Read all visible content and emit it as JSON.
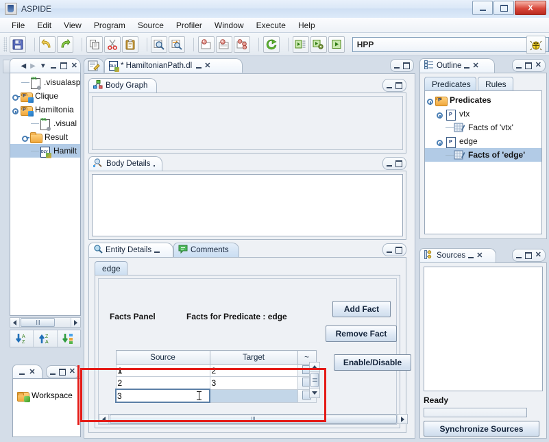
{
  "window": {
    "title": "ASPIDE",
    "icon": "java-app-icon",
    "buttons": {
      "minimize": "minimize",
      "maximize": "maximize",
      "close": "X"
    }
  },
  "menubar": {
    "items": [
      "File",
      "Edit",
      "View",
      "Program",
      "Source",
      "Profiler",
      "Window",
      "Execute",
      "Help"
    ]
  },
  "toolbar": {
    "groups": [
      {
        "buttons": [
          {
            "icon": "save-icon"
          }
        ]
      },
      {
        "buttons": [
          {
            "icon": "undo-icon"
          },
          {
            "icon": "redo-icon"
          }
        ]
      },
      {
        "buttons": [
          {
            "icon": "copy-icon"
          },
          {
            "icon": "cut-icon"
          },
          {
            "icon": "paste-icon"
          }
        ]
      },
      {
        "buttons": [
          {
            "icon": "find-icon"
          },
          {
            "icon": "find-replace-icon"
          }
        ]
      },
      {
        "buttons": [
          {
            "icon": "breakpoint-icon"
          },
          {
            "icon": "breakpoints-2-icon"
          },
          {
            "icon": "breakpoints-3-icon"
          }
        ]
      },
      {
        "buttons": [
          {
            "icon": "refresh-icon"
          }
        ]
      },
      {
        "buttons": [
          {
            "icon": "run-step-icon"
          },
          {
            "icon": "run-config-icon"
          },
          {
            "icon": "run-icon"
          }
        ]
      }
    ],
    "run_config": {
      "value": "HPP",
      "placeholder": "HPP"
    },
    "debug_button": {
      "icon": "bug-icon"
    }
  },
  "explorer": {
    "titlebar_icon": "explorer-icon",
    "nav": {
      "back": "back-icon",
      "forward": "forward-icon",
      "menu": "dropdown-icon"
    },
    "frame_buttons": [
      "minimize",
      "maximize",
      "close"
    ],
    "tree": [
      {
        "label": ".visualasp",
        "icon": "xml-file-icon",
        "depth": 1,
        "expander": "none",
        "selected": false
      },
      {
        "label": "Clique",
        "icon": "project-folder-icon",
        "depth": 0,
        "expander": "collapsed",
        "selected": false
      },
      {
        "label": "Hamiltonia",
        "icon": "project-folder-icon",
        "depth": 0,
        "expander": "expanded",
        "selected": false
      },
      {
        "label": ".visual",
        "icon": "xml-file-icon",
        "depth": 1,
        "expander": "none",
        "selected": false
      },
      {
        "label": "Result",
        "icon": "folder-icon",
        "depth": 1,
        "expander": "collapsed",
        "selected": false
      },
      {
        "label": "Hamilt",
        "icon": "dlv-file-icon",
        "depth": 1,
        "expander": "none",
        "selected": true
      }
    ],
    "hscroll": {
      "left": "scroll-left",
      "right": "scroll-right"
    },
    "sort_buttons": [
      {
        "icon": "sort-az-icon"
      },
      {
        "icon": "sort-za-icon"
      },
      {
        "icon": "sort-tree-icon"
      }
    ]
  },
  "workspace_panel": {
    "tab_label": "",
    "frame_buttons": [
      "minimize",
      "maximize",
      "close"
    ],
    "items": [
      {
        "label": "Workspace",
        "icon": "workspace-folder-icon"
      }
    ]
  },
  "editor": {
    "icon_tab": "editor-icon",
    "tab": {
      "label": "* HamiltonianPath.dl",
      "icon": "dlv-file-icon",
      "modified": true
    },
    "frame_buttons": [
      "minimize",
      "maximize"
    ],
    "body_graph": {
      "title": "Body Graph",
      "icon": "graph-icon",
      "content": ""
    },
    "body_details": {
      "title": "Body Details",
      "icon": "details-icon",
      "content": ""
    },
    "entity_details": {
      "tabs": [
        {
          "label": "Entity Details",
          "icon": "magnifier-icon",
          "selected": true
        },
        {
          "label": "Comments",
          "icon": "comment-icon",
          "selected": false
        }
      ],
      "predicate_tab": "edge",
      "facts_panel_label": "Facts Panel",
      "facts_for_predicate_label": "Facts for Predicate :  edge",
      "add_fact_button": "Add Fact",
      "remove_fact_button": "Remove Fact",
      "enable_disable_button": "Enable/Disable",
      "table": {
        "columns": [
          "Source",
          "Target",
          "~"
        ],
        "rows": [
          {
            "source": "1",
            "target": "2",
            "enabled": false,
            "source_bold": true
          },
          {
            "source": "2",
            "target": "3",
            "enabled": false,
            "source_bold": false
          },
          {
            "source": "3",
            "target": "",
            "enabled": false,
            "source_bold": false,
            "editing": "source",
            "target_selected": true
          }
        ]
      }
    }
  },
  "outline": {
    "title": "Outline",
    "icon": "outline-icon",
    "frame_buttons": [
      "minimize",
      "maximize",
      "close"
    ],
    "tabs": [
      {
        "label": "Predicates",
        "selected": true
      },
      {
        "label": "Rules",
        "selected": false
      }
    ],
    "tree": [
      {
        "label": "Predicates",
        "icon": "predicates-folder-icon",
        "depth": 0,
        "expander": "expanded",
        "selected": false,
        "bold": true
      },
      {
        "label": "vtx",
        "icon": "predicate-icon",
        "depth": 1,
        "expander": "expanded",
        "selected": false,
        "bold": false
      },
      {
        "label": "Facts of 'vtx'",
        "icon": "facts-table-icon",
        "depth": 2,
        "expander": "none",
        "selected": false,
        "bold": false
      },
      {
        "label": "edge",
        "icon": "predicate-icon",
        "depth": 1,
        "expander": "expanded",
        "selected": false,
        "bold": false
      },
      {
        "label": "Facts of 'edge'",
        "icon": "facts-table-icon",
        "depth": 2,
        "expander": "none",
        "selected": true,
        "bold": true
      }
    ]
  },
  "sources": {
    "title": "Sources",
    "icon": "sources-icon",
    "frame_buttons": [
      "minimize",
      "maximize",
      "close"
    ],
    "list": [],
    "status": "Ready",
    "progress_value": "",
    "sync_button": "Synchronize Sources"
  },
  "annotation": {
    "color": "#e41b17",
    "label": "facts-table-highlight"
  }
}
